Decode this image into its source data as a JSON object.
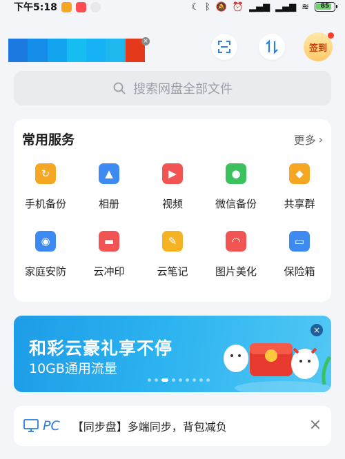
{
  "status_bar": {
    "time": "下午5:18",
    "battery": "85"
  },
  "header": {
    "signin_label": "签到"
  },
  "search": {
    "placeholder": "搜索网盘全部文件"
  },
  "services": {
    "title": "常用服务",
    "more_label": "更多",
    "items": [
      {
        "label": "手机备份",
        "icon": "phone-backup-icon",
        "color": "#f5a623"
      },
      {
        "label": "相册",
        "icon": "album-icon",
        "color": "#3d8bf2"
      },
      {
        "label": "视频",
        "icon": "video-icon",
        "color": "#f25454"
      },
      {
        "label": "微信备份",
        "icon": "wechat-backup-icon",
        "color": "#3cc15f"
      },
      {
        "label": "共享群",
        "icon": "share-group-icon",
        "color": "#f5a623"
      },
      {
        "label": "家庭安防",
        "icon": "home-camera-icon",
        "color": "#3d8bf2"
      },
      {
        "label": "云冲印",
        "icon": "cloud-print-icon",
        "color": "#f25454"
      },
      {
        "label": "云笔记",
        "icon": "cloud-note-icon",
        "color": "#f5b323"
      },
      {
        "label": "图片美化",
        "icon": "photo-beautify-icon",
        "color": "#f25454"
      },
      {
        "label": "保险箱",
        "icon": "safe-box-icon",
        "color": "#3d8bf2"
      }
    ]
  },
  "banner": {
    "title": "和彩云豪礼享不停",
    "subtitle": "10GB通用流量"
  },
  "tip": {
    "pc_label": "PC",
    "text": "【同步盘】多端同步，背包减负"
  }
}
